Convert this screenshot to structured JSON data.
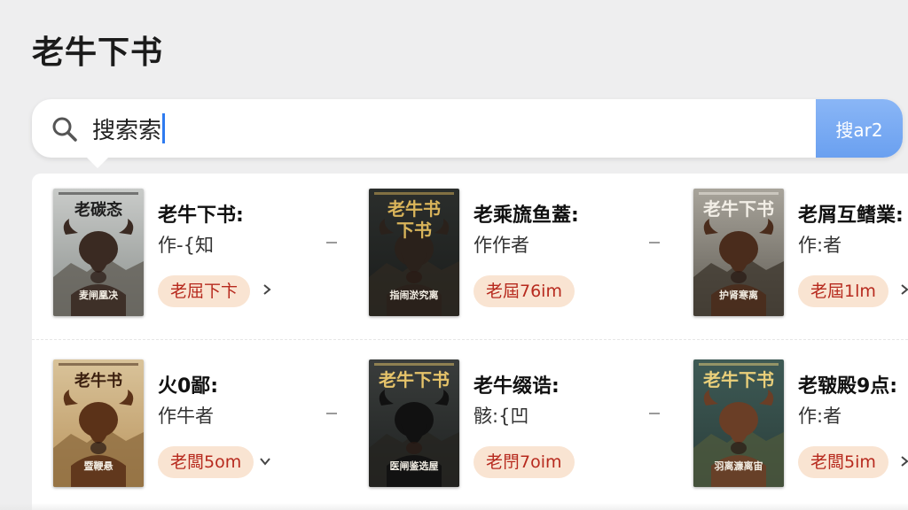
{
  "app": {
    "title": "老牛下书"
  },
  "search": {
    "value": "搜索索",
    "button_label": "搜ar2"
  },
  "colors": {
    "accent": "#6aa0f0",
    "badge_bg": "#f9e4d2",
    "badge_text": "#b72a1e"
  },
  "books": [
    {
      "title": "老牛下书:",
      "author": "作-{知",
      "badge": "老屈下卞",
      "cover_title": "老碳忞",
      "cover_sub": "麦闸凰决",
      "cover_theme": "grey",
      "chevron": "right"
    },
    {
      "title": "老乘旒鱼蓋:",
      "author": "作作者",
      "badge": "老屆76im",
      "cover_title": "老牛书\n下书",
      "cover_sub": "指闹淤究离",
      "cover_theme": "dark",
      "chevron": "none"
    },
    {
      "title": "老屑互鳍業:",
      "author": "作:者",
      "badge": "老屆1lm",
      "cover_title": "老牛下书",
      "cover_sub": "护肾寒离",
      "cover_theme": "dusk",
      "chevron": "right"
    },
    {
      "title": "火0鄙:",
      "author": "作牛者",
      "badge": "老闆5om",
      "cover_title": "老牛书",
      "cover_sub": "暨鞭悬",
      "cover_theme": "sepia",
      "chevron": "down"
    },
    {
      "title": "老牛缀诰:",
      "author": "骸:{凹",
      "badge": "老閅7oim",
      "cover_title": "老牛下书",
      "cover_sub": "医闸鉴选屋",
      "cover_theme": "black",
      "chevron": "none"
    },
    {
      "title": "老皲殿9点:",
      "author": "作:者",
      "badge": "老闆5im",
      "cover_title": "老牛下书",
      "cover_sub": "羽离濂离宙",
      "cover_theme": "green",
      "chevron": "right"
    }
  ]
}
